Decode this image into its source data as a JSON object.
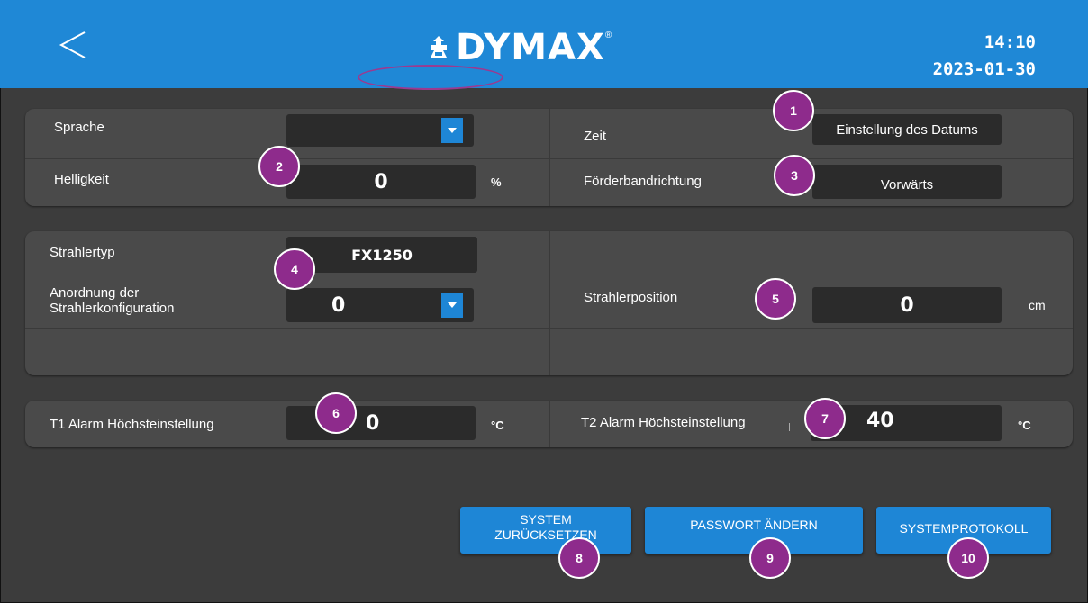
{
  "header": {
    "brand": "DYMAX",
    "brand_reg": "®",
    "time": "14:10",
    "date": "2023-01-30"
  },
  "settings": {
    "language_label": "Sprache",
    "language_value": "",
    "time_label": "Zeit",
    "date_button": "Einstellung des Datums",
    "brightness_label": "Helligkeit",
    "brightness_value": "0",
    "brightness_unit": "%",
    "conveyor_label": "Förderbandrichtung",
    "conveyor_value": "Vorwärts"
  },
  "lamp": {
    "type_label": "Strahlertyp",
    "type_value": "FX1250",
    "arrangement_label_line1": "Anordnung der",
    "arrangement_label_line2": "Strahlerkonfiguration",
    "arrangement_value": "0",
    "position_label": "Strahlerposition",
    "position_value": "0",
    "position_unit": "cm"
  },
  "alarms": {
    "t1_label": "T1 Alarm Höchsteinstellung",
    "t1_value": "0",
    "t1_unit": "°C",
    "t2_label": "T2 Alarm Höchsteinstellung",
    "t2_value": "40",
    "t2_unit": "°C"
  },
  "buttons": {
    "reset_line1": "SYSTEM",
    "reset_line2": "ZURÜCKSETZEN",
    "password": "PASSWORT ÄNDERN",
    "log": "SYSTEMPROTOKOLL"
  },
  "markers": [
    "1",
    "2",
    "3",
    "4",
    "5",
    "6",
    "7",
    "8",
    "9",
    "10"
  ],
  "colors": {
    "header": "#1f88d6",
    "marker": "#8e2b8c",
    "button": "#1e86d6",
    "panel": "#4a4a4a"
  }
}
